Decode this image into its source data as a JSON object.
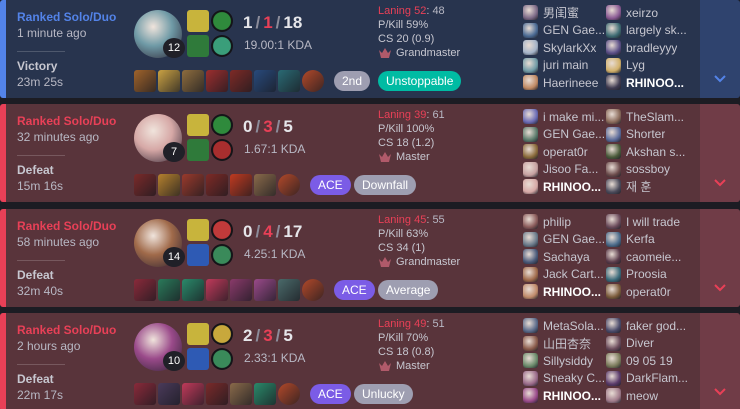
{
  "matches": [
    {
      "outcome": "win",
      "queue": "Ranked Solo/Duo",
      "time_ago": "1 minute ago",
      "result": "Victory",
      "duration": "23m 25s",
      "champ_level": "12",
      "kills": "1",
      "deaths": "1",
      "assists": "18",
      "kda_ratio": "19.00:1 KDA",
      "laning": "Laning 52",
      "laning_opp": ": 48",
      "pkill": "P/Kill 59%",
      "cs": "CS 20 (0.9)",
      "tier": "Grandmaster",
      "tags": [
        {
          "label": "2nd",
          "style": "grey"
        },
        {
          "label": "Unstoppable",
          "style": "green"
        }
      ],
      "champ_color": "#6f9aa6",
      "spells": [
        "#c8b43c",
        "#2f7a3a"
      ],
      "runes": [
        "#2f8a3c",
        "#3a9e7a"
      ],
      "items": [
        "#a0632b",
        "#caa243",
        "#8e6d3e",
        "#9c2e2e",
        "#7e2a26",
        "#284a7c",
        "#2a6a74",
        "#b3492a"
      ],
      "team_a": [
        {
          "name": "男闺蜜",
          "color": "#7d6a87"
        },
        {
          "name": "GEN Gae...",
          "color": "#4a6a94"
        },
        {
          "name": "SkylarkXx",
          "color": "#a4b3c8"
        },
        {
          "name": "juri main",
          "color": "#6f9aa6"
        },
        {
          "name": "Haerineee",
          "color": "#c08a64"
        }
      ],
      "team_b": [
        {
          "name": "xeirzo",
          "color": "#8a5a94"
        },
        {
          "name": "largely sk...",
          "color": "#3c6a72"
        },
        {
          "name": "bradleyyy",
          "color": "#5a4e86"
        },
        {
          "name": "Lyg",
          "color": "#d1b06a"
        },
        {
          "name": "RHINOO...",
          "color": "#3e3a50"
        }
      ],
      "me": "b4"
    },
    {
      "outcome": "loss",
      "queue": "Ranked Solo/Duo",
      "time_ago": "32 minutes ago",
      "result": "Defeat",
      "duration": "15m 16s",
      "champ_level": "7",
      "kills": "0",
      "deaths": "3",
      "assists": "5",
      "kda_ratio": "1.67:1 KDA",
      "laning": "Laning 39",
      "laning_opp": ": 61",
      "pkill": "P/Kill 100%",
      "cs": "CS 18 (1.2)",
      "tier": "Master",
      "tags": [
        {
          "label": "ACE",
          "style": "purple"
        },
        {
          "label": "Downfall",
          "style": "grey"
        }
      ],
      "champ_color": "#d6a8a6",
      "spells": [
        "#c8b43c",
        "#2f7a3a"
      ],
      "runes": [
        "#2f8a3c",
        "#a82e2e"
      ],
      "items": [
        "#7a2a2a",
        "#b5812e",
        "#9a3a2c",
        "#7e2a26",
        "#c03a20",
        "#8a6a4a",
        "#b3492a"
      ],
      "team_a": [
        {
          "name": "i make mi...",
          "color": "#6a6ab4"
        },
        {
          "name": "GEN Gae...",
          "color": "#5a7a6a"
        },
        {
          "name": "operat0r",
          "color": "#8a6a3a"
        },
        {
          "name": "Jisoo Fa...",
          "color": "#c6a0a0"
        },
        {
          "name": "RHINOO...",
          "color": "#d6a8a6"
        }
      ],
      "team_b": [
        {
          "name": "TheSlam...",
          "color": "#8a6a5a"
        },
        {
          "name": "Shorter",
          "color": "#5a6a9a"
        },
        {
          "name": "Akshan s...",
          "color": "#4a5a3a"
        },
        {
          "name": "sossboy",
          "color": "#6a4a4a"
        },
        {
          "name": "재 훈",
          "color": "#4a4a5a"
        }
      ],
      "me": "a4"
    },
    {
      "outcome": "loss",
      "queue": "Ranked Solo/Duo",
      "time_ago": "58 minutes ago",
      "result": "Defeat",
      "duration": "32m 40s",
      "champ_level": "14",
      "kills": "0",
      "deaths": "4",
      "assists": "17",
      "kda_ratio": "4.25:1 KDA",
      "laning": "Laning 45",
      "laning_opp": ": 55",
      "pkill": "P/Kill 63%",
      "cs": "CS 34 (1)",
      "tier": "Grandmaster",
      "tags": [
        {
          "label": "ACE",
          "style": "purple"
        },
        {
          "label": "Average",
          "style": "grey"
        }
      ],
      "champ_color": "#a06a4a",
      "spells": [
        "#c8b43c",
        "#2e5ab4"
      ],
      "runes": [
        "#c03a3a",
        "#3a8a5a"
      ],
      "items": [
        "#8a2a3a",
        "#2a7a5a",
        "#2a8a6a",
        "#c03a5a",
        "#8a3a6a",
        "#9a4a8a",
        "#4a6a6a",
        "#b3492a"
      ],
      "team_a": [
        {
          "name": "philip",
          "color": "#8a5a5a"
        },
        {
          "name": "GEN Gae...",
          "color": "#6a7a8a"
        },
        {
          "name": "Sachaya",
          "color": "#4a5a7a"
        },
        {
          "name": "Jack Cart...",
          "color": "#a06a4a"
        },
        {
          "name": "RHINOO...",
          "color": "#c08a6a"
        }
      ],
      "team_b": [
        {
          "name": "I will trade",
          "color": "#6a4a5a"
        },
        {
          "name": "Kerfa",
          "color": "#4a6a8a"
        },
        {
          "name": "caomeie...",
          "color": "#5a3a4a"
        },
        {
          "name": "Proosia",
          "color": "#3a6a7a"
        },
        {
          "name": "operat0r",
          "color": "#7a5a3a"
        }
      ],
      "me": "a4"
    },
    {
      "outcome": "loss",
      "queue": "Ranked Solo/Duo",
      "time_ago": "2 hours ago",
      "result": "Defeat",
      "duration": "22m 17s",
      "champ_level": "10",
      "kills": "2",
      "deaths": "3",
      "assists": "5",
      "kda_ratio": "2.33:1 KDA",
      "laning": "Laning 49",
      "laning_opp": ": 51",
      "pkill": "P/Kill 70%",
      "cs": "CS 18 (0.8)",
      "tier": "Master",
      "tags": [
        {
          "label": "ACE",
          "style": "purple"
        },
        {
          "label": "Unlucky",
          "style": "grey"
        }
      ],
      "champ_color": "#9a4a8a",
      "spells": [
        "#c8b43c",
        "#2e5ab4"
      ],
      "runes": [
        "#c8a83c",
        "#3a8a5a"
      ],
      "items": [
        "#8a2a3a",
        "#4a3a5a",
        "#c03a5a",
        "#7a2a2a",
        "#8a6a4a",
        "#2a8a6a",
        "#b3492a"
      ],
      "team_a": [
        {
          "name": "MetaSola...",
          "color": "#5a6a8a"
        },
        {
          "name": "山田杏奈",
          "color": "#8a5a4a"
        },
        {
          "name": "Sillysiddy",
          "color": "#6a8a6a"
        },
        {
          "name": "Sneaky C...",
          "color": "#9a6a8a"
        },
        {
          "name": "RHINOO...",
          "color": "#9a4a8a"
        }
      ],
      "team_b": [
        {
          "name": "faker god...",
          "color": "#4a4a6a"
        },
        {
          "name": "Diver",
          "color": "#6a4a5a"
        },
        {
          "name": "09 05 19",
          "color": "#7a7a5a"
        },
        {
          "name": "DarkFlam...",
          "color": "#5a3a6a"
        },
        {
          "name": "meow",
          "color": "#a07a8a"
        }
      ],
      "me": "a4"
    }
  ],
  "expand_icon": "chevron-down-icon"
}
